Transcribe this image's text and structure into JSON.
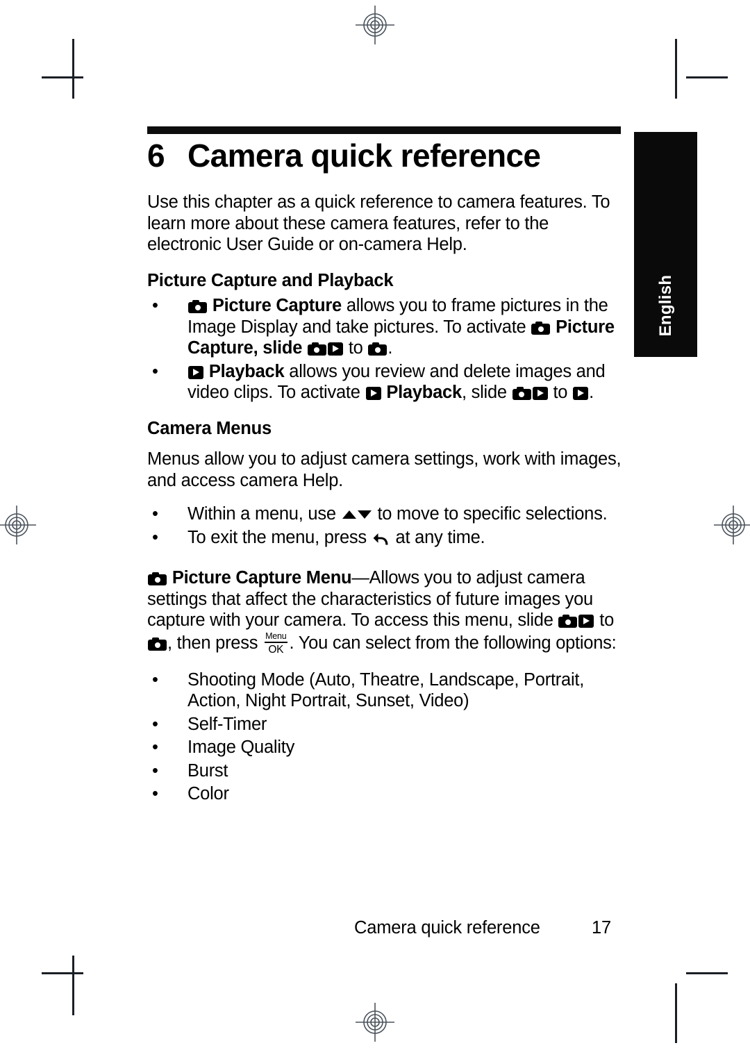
{
  "page": {
    "chapter_number": "6",
    "chapter_title": "Camera quick reference",
    "language_tab": "English",
    "footer_text": "Camera quick reference",
    "page_number": "17"
  },
  "intro": {
    "text": "Use this chapter as a quick reference to camera features. To learn more about these camera features, refer to the electronic User Guide or on-camera Help."
  },
  "section_capture": {
    "heading": "Picture Capture and Playback",
    "bullet1": {
      "bold_label": "Picture Capture",
      "text_a": " allows you to frame pictures in the Image Display and take pictures. To activate ",
      "bold_label2": "Picture Capture",
      "text_b": ", slide ",
      "text_c": " to ",
      "text_d": "."
    },
    "bullet2": {
      "bold_label": "Playback",
      "text_a": " allows you review and delete images and video clips. To activate ",
      "bold_label2": "Playback",
      "text_b": ", slide ",
      "text_c": " to ",
      "text_d": "."
    }
  },
  "section_menus": {
    "heading": "Camera Menus",
    "intro": "Menus allow you to adjust camera settings, work with images, and access camera Help.",
    "bullet1_a": "Within a menu, use ",
    "bullet1_b": " to move to specific selections.",
    "bullet2_a": "To exit the menu, press ",
    "bullet2_b": " at any time."
  },
  "capture_menu": {
    "bold_label": "Picture Capture Menu",
    "text_a": "—Allows you to adjust camera settings that affect the characteristics of future images you capture with your camera. To access this menu, slide ",
    "text_b": " to ",
    "text_c": ", then press ",
    "text_d": ". You can select from the following options:",
    "menu_key_top": "Menu",
    "menu_key_bottom": "OK",
    "options": [
      "Shooting Mode (Auto, Theatre, Landscape, Portrait, Action, Night Portrait, Sunset, Video)",
      "Self-Timer",
      "Image Quality",
      "Burst",
      "Color"
    ]
  },
  "bullet_glyph": "•",
  "icons": {
    "camera": "camera-icon",
    "playback": "playback-icon",
    "updown": "up-down-arrows-icon",
    "back": "back-arrow-icon",
    "menu_ok": "menu-ok-key-icon"
  },
  "colors": {
    "ink": "#000000",
    "paper": "#ffffff",
    "tab": "#0a0a0a",
    "crop_mark": "#1a1f26"
  }
}
